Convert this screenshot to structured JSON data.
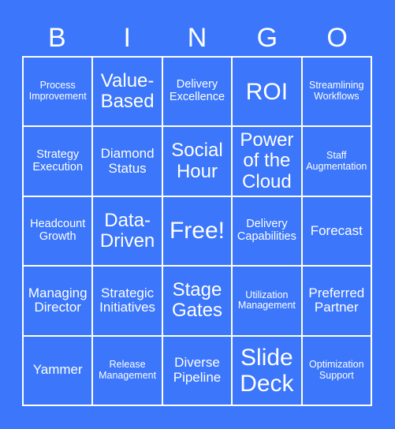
{
  "header": [
    "B",
    "I",
    "N",
    "G",
    "O"
  ],
  "colors": {
    "background": "#3b76fb",
    "text": "#ffffff",
    "grid_line": "#ffffff"
  },
  "cells": [
    {
      "text": "Process Improvement",
      "size": "s1"
    },
    {
      "text": "Value-Based",
      "size": "s4"
    },
    {
      "text": "Delivery Excellence",
      "size": "s2"
    },
    {
      "text": "ROI",
      "size": "s5"
    },
    {
      "text": "Streamlining Workflows",
      "size": "s1"
    },
    {
      "text": "Strategy Execution",
      "size": "s2"
    },
    {
      "text": "Diamond Status",
      "size": "s3"
    },
    {
      "text": "Social Hour",
      "size": "s4"
    },
    {
      "text": "Power of the Cloud",
      "size": "s4"
    },
    {
      "text": "Staff Augmentation",
      "size": "s1"
    },
    {
      "text": "Headcount Growth",
      "size": "s2"
    },
    {
      "text": "Data-Driven",
      "size": "s4"
    },
    {
      "text": "Free!",
      "size": "s5"
    },
    {
      "text": "Delivery Capabilities",
      "size": "s2"
    },
    {
      "text": "Forecast",
      "size": "s3"
    },
    {
      "text": "Managing Director",
      "size": "s3"
    },
    {
      "text": "Strategic Initiatives",
      "size": "s3"
    },
    {
      "text": "Stage Gates",
      "size": "s4"
    },
    {
      "text": "Utilization Management",
      "size": "s1"
    },
    {
      "text": "Preferred Partner",
      "size": "s3"
    },
    {
      "text": "Yammer",
      "size": "s3"
    },
    {
      "text": "Release Management",
      "size": "s1"
    },
    {
      "text": "Diverse Pipeline",
      "size": "s3"
    },
    {
      "text": "Slide Deck",
      "size": "s5"
    },
    {
      "text": "Optimization Support",
      "size": "s1"
    }
  ]
}
